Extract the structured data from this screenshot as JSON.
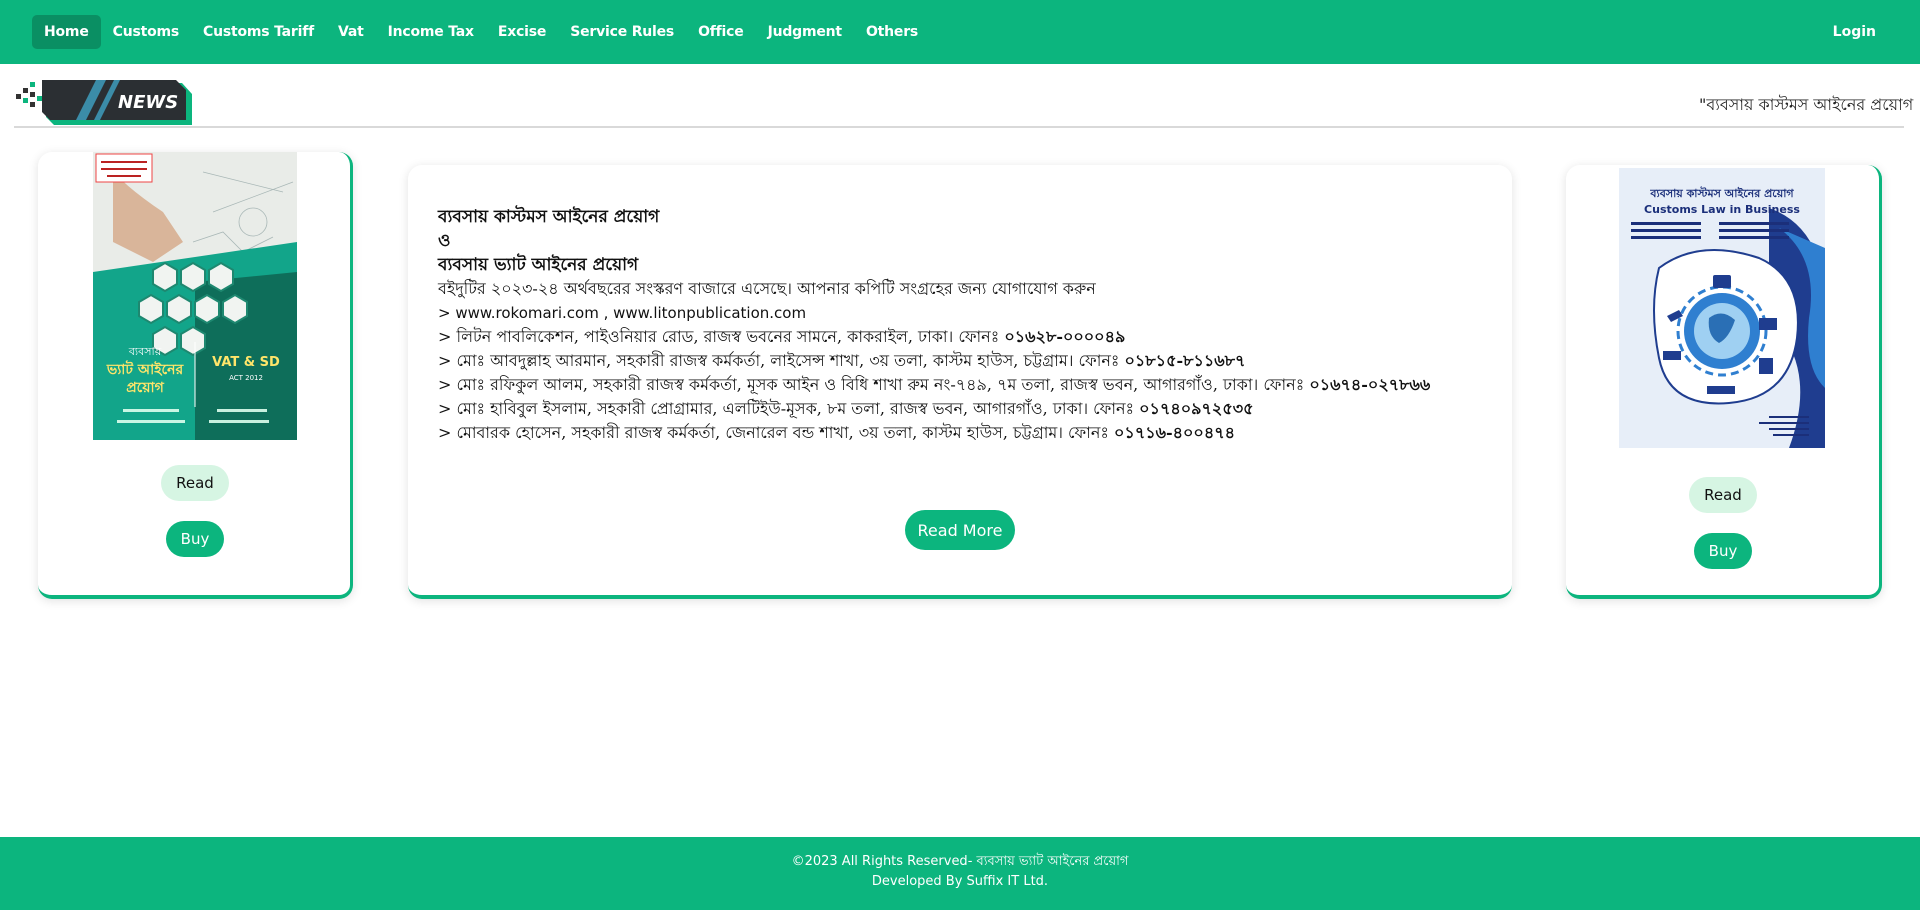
{
  "nav": {
    "items": [
      {
        "label": "Home",
        "active": true
      },
      {
        "label": "Customs"
      },
      {
        "label": "Customs Tariff"
      },
      {
        "label": "Vat"
      },
      {
        "label": "Income Tax"
      },
      {
        "label": "Excise"
      },
      {
        "label": "Service Rules"
      },
      {
        "label": "Office"
      },
      {
        "label": "Judgment"
      },
      {
        "label": "Others"
      }
    ],
    "login_label": "Login"
  },
  "news": {
    "badge_label": "NEWS",
    "ticker_text": "\"ব্যবসায় কাস্টমস আইনের প্রয়োগ"
  },
  "left_card": {
    "cover_texts": {
      "title_line1": "ব্যবসায়",
      "title_line2": "ভ্যাট আইনের",
      "title_line3": "প্রয়োগ",
      "vat_label": "VAT & SD",
      "act_label": "ACT 2012"
    },
    "read_label": "Read",
    "buy_label": "Buy"
  },
  "mid_card": {
    "title_line1": "ব্যবসায় কাস্টমস আইনের প্রয়োগ",
    "title_line2": "ও",
    "title_line3": "ব্যবসায় ভ্যাট আইনের প্রয়োগ",
    "subtitle": "বইদুটির ২০২৩-২৪ অর্থবছরের সংস্করণ বাজারে এসেছে। আপনার কপিটি সংগ্রহের জন্য যোগাযোগ করুন",
    "web_line": "> www.rokomari.com , www.litonpublication.com",
    "contacts": [
      {
        "text": "> লিটন পাবলিকেশন, পাইওনিয়ার রোড, রাজস্ব ভবনের সামনে, কাকরাইল, ঢাকা। ফোনঃ ",
        "phone": "০১৬২৮-০০০০৪৯"
      },
      {
        "text": "> মোঃ আবদুল্লাহ আরমান, সহকারী রাজস্ব কর্মকর্তা, লাইসেন্স শাখা, ৩য় তলা, কাস্টম হাউস, চট্টগ্রাম। ফোনঃ ",
        "phone": "০১৮১৫-৮১১৬৮৭"
      },
      {
        "text": "> মোঃ রফিকুল আলম, সহকারী রাজস্ব কর্মকর্তা, মূসক আইন ও বিধি শাখা রুম নং-৭৪৯, ৭ম তলা, রাজস্ব ভবন, আগারগাঁও, ঢাকা। ফোনঃ ",
        "phone": "০১৬৭৪-০২৭৮৬৬"
      },
      {
        "text": "> মোঃ হাবিবুল ইসলাম, সহকারী প্রোগ্রামার, এলটিইউ-মূসক, ৮ম তলা, রাজস্ব ভবন, আগারগাঁও, ঢাকা। ফোনঃ ",
        "phone": "০১৭৪০৯৭২৫৩৫"
      },
      {
        "text": "> মোবারক হোসেন, সহকারী রাজস্ব কর্মকর্তা, জেনারেল বন্ড শাখা, ৩য় তলা, কাস্টম হাউস, চট্টগ্রাম। ফোনঃ ",
        "phone": "০১৭১৬-৪০০৪৭৪"
      }
    ],
    "read_more_label": "Read More"
  },
  "right_card": {
    "cover_texts": {
      "title_bn": "ব্যবসায় কাস্টমস আইনের প্রয়োগ",
      "title_en": "Customs Law in Business"
    },
    "read_label": "Read",
    "buy_label": "Buy"
  },
  "footer": {
    "copyright": "©2023 All Rights Reserved- ব্যবসায় ভ্যাট আইনের প্রয়োগ",
    "developed_by": "Developed By Suffix IT Ltd."
  },
  "colors": {
    "brand_green": "#0cb57e",
    "active_nav": "#0a8f63",
    "read_button_bg": "#d6f5e3"
  }
}
